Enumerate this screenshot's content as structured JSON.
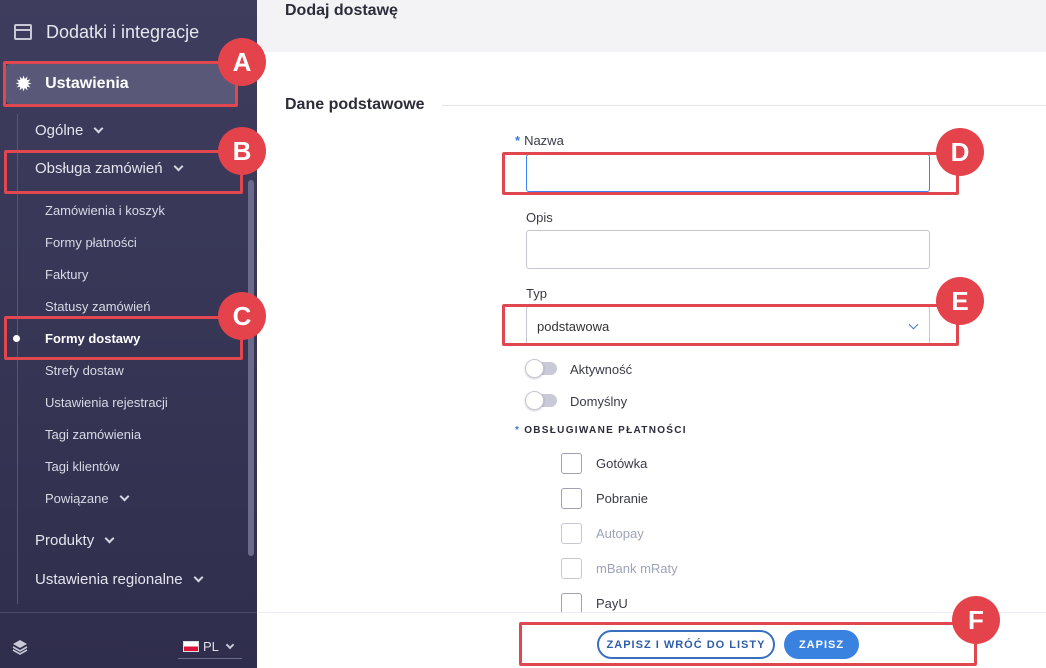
{
  "sidebar": {
    "top_item": "Dodatki i integracje",
    "active_item": "Ustawienia",
    "groups": {
      "ogolne": "Ogólne",
      "obsluga": "Obsługa zamówień",
      "produkty": "Produkty",
      "regionalne": "Ustawienia regionalne"
    },
    "sub_items": [
      "Zamówienia i koszyk",
      "Formy płatności",
      "Faktury",
      "Statusy zamówień",
      "Formy dostawy",
      "Strefy dostaw",
      "Ustawienia rejestracji",
      "Tagi zamówienia",
      "Tagi klientów",
      "Powiązane"
    ],
    "selected_sub_item": "Formy dostawy",
    "language": "PL"
  },
  "page": {
    "title": "Dodaj dostawę",
    "section_title": "Dane podstawowe"
  },
  "form": {
    "name_label": "Nazwa",
    "name_value": "",
    "description_label": "Opis",
    "description_value": "",
    "type_label": "Typ",
    "type_value": "podstawowa",
    "toggles": [
      {
        "label": "Aktywność",
        "on": false
      },
      {
        "label": "Domyślny",
        "on": false
      }
    ],
    "payments_label": "OBSŁUGIWANE PŁATNOŚCI",
    "payments": [
      {
        "label": "Gotówka",
        "enabled": true,
        "checked": false
      },
      {
        "label": "Pobranie",
        "enabled": true,
        "checked": false
      },
      {
        "label": "Autopay",
        "enabled": false,
        "checked": false
      },
      {
        "label": "mBank mRaty",
        "enabled": false,
        "checked": false
      },
      {
        "label": "PayU",
        "enabled": true,
        "checked": false
      }
    ]
  },
  "footer": {
    "save_and_return": "ZAPISZ I WRÓĆ DO LISTY",
    "save": "ZAPISZ"
  },
  "annotations": [
    "A",
    "B",
    "C",
    "D",
    "E",
    "F"
  ],
  "colors": {
    "sidebar_bg": "#3e3d5e",
    "active_item_bg": "#5a5878",
    "accent": "#3a82e0",
    "annotation": "#e5434b"
  }
}
